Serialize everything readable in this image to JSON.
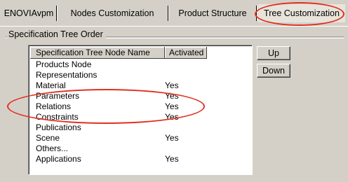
{
  "tabs": [
    {
      "label": "ENOVIAvpm"
    },
    {
      "label": "Nodes Customization"
    },
    {
      "label": "Product Structure"
    },
    {
      "label": "Tree Customization"
    }
  ],
  "group_title": "Specification Tree Order",
  "list": {
    "columns": [
      "Specification Tree Node Name",
      "Activated"
    ],
    "rows": [
      {
        "name": "Products Node",
        "activated": ""
      },
      {
        "name": "Representations",
        "activated": ""
      },
      {
        "name": "Material",
        "activated": "Yes"
      },
      {
        "name": "Parameters",
        "activated": "Yes"
      },
      {
        "name": "Relations",
        "activated": "Yes"
      },
      {
        "name": "Constraints",
        "activated": "Yes"
      },
      {
        "name": "Publications",
        "activated": ""
      },
      {
        "name": "Scene",
        "activated": "Yes"
      },
      {
        "name": "Others...",
        "activated": ""
      },
      {
        "name": "Applications",
        "activated": "Yes"
      }
    ]
  },
  "buttons": {
    "up": "Up",
    "down": "Down"
  },
  "annotation_color": "#e03020"
}
